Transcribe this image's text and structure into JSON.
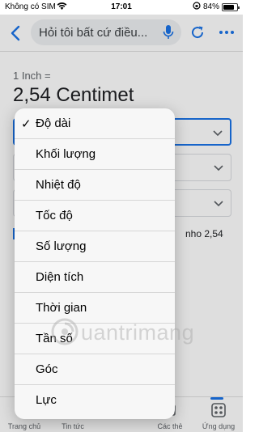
{
  "status_bar": {
    "carrier": "Không có SIM",
    "time": "17:01",
    "battery_percent": "84%",
    "battery_level": 0.84
  },
  "top_bar": {
    "search_text": "Hỏi tôi bất cứ điều..."
  },
  "converter": {
    "from_text": "1 Inch =",
    "result_text": "2,54 Centimet",
    "footnote": "nho 2,54"
  },
  "dropdown": {
    "selected_index": 0,
    "items": [
      {
        "label": "Độ dài",
        "checked": true
      },
      {
        "label": "Khối lượng",
        "checked": false
      },
      {
        "label": "Nhiệt độ",
        "checked": false
      },
      {
        "label": "Tốc độ",
        "checked": false
      },
      {
        "label": "Số lượng",
        "checked": false
      },
      {
        "label": "Diện tích",
        "checked": false
      },
      {
        "label": "Thời gian",
        "checked": false
      },
      {
        "label": "Tần số",
        "checked": false
      },
      {
        "label": "Góc",
        "checked": false
      },
      {
        "label": "Lực",
        "checked": false
      }
    ]
  },
  "bottom_nav": {
    "items": [
      {
        "label": "Trang chủ",
        "icon": "home-icon"
      },
      {
        "label": "Tin tức",
        "icon": "news-icon"
      },
      {
        "label": "",
        "icon": "discover-icon"
      },
      {
        "label": "Các thẻ",
        "icon": "tabs-icon"
      },
      {
        "label": "Ứng dụng",
        "icon": "apps-icon"
      }
    ],
    "active_index": 4
  },
  "watermark": {
    "text": "uantrimang"
  },
  "colors": {
    "accent": "#1a73e8",
    "dropdown_bg": "#f7f7f7"
  }
}
